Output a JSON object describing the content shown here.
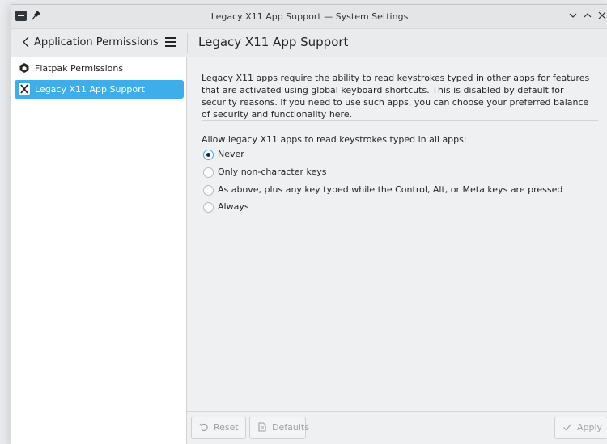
{
  "window": {
    "title": "Legacy X11 App Support — System Settings"
  },
  "header": {
    "back_label": "Application Permissions",
    "page_title": "Legacy X11 App Support"
  },
  "sidebar": {
    "items": [
      {
        "label": "Flatpak Permissions",
        "icon": "flatpak-icon",
        "selected": false
      },
      {
        "label": "Legacy X11 App Support",
        "icon": "x11-icon",
        "selected": true
      }
    ]
  },
  "main": {
    "description": "Legacy X11 apps require the ability to read keystrokes typed in other apps for features that are activated using global keyboard shortcuts. This is disabled by default for security reasons. If you need to use such apps, you can choose your preferred balance of security and functionality here.",
    "question": "Allow legacy X11 apps to read keystrokes typed in all apps:",
    "options": [
      {
        "label": "Never",
        "checked": true
      },
      {
        "label": "Only non-character keys",
        "checked": false
      },
      {
        "label": "As above, plus any key typed while the Control, Alt, or Meta keys are pressed",
        "checked": false
      },
      {
        "label": "Always",
        "checked": false
      }
    ]
  },
  "footer": {
    "reset_label": "Reset",
    "defaults_label": "Defaults",
    "apply_label": "Apply"
  },
  "colors": {
    "accent": "#3daee9",
    "text": "#232629",
    "disabled_text": "#9ea1a3"
  }
}
